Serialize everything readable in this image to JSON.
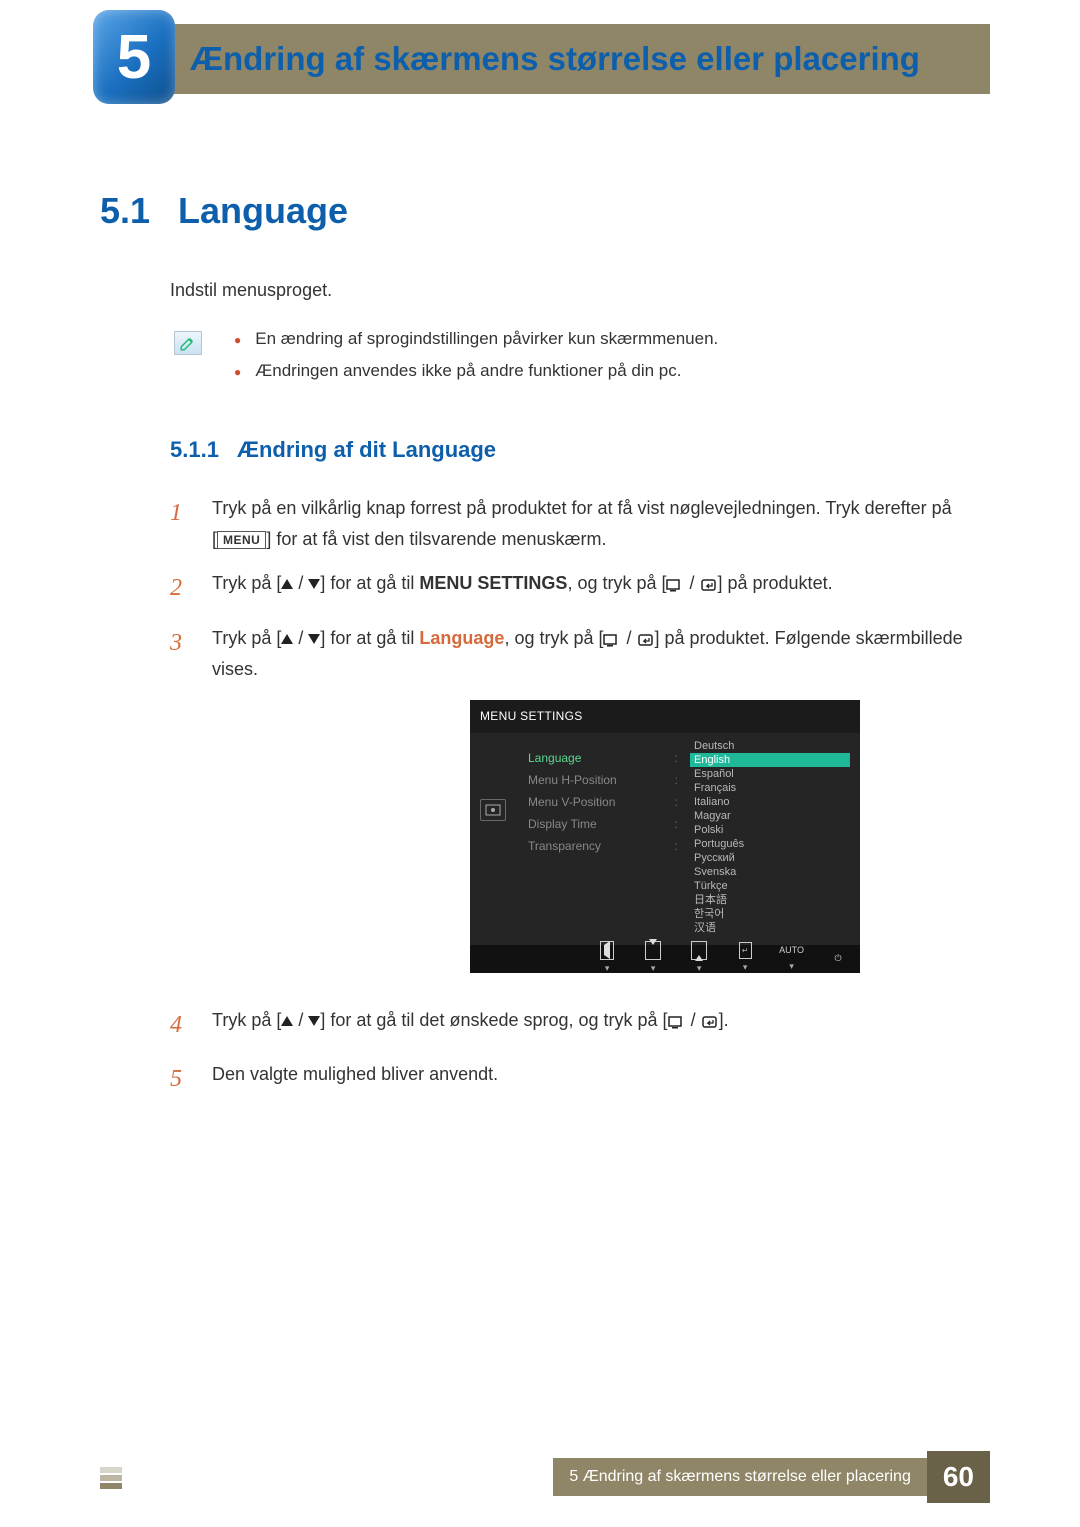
{
  "chapter_number": "5",
  "chapter_title": "Ændring af skærmens størrelse eller placering",
  "section": {
    "number": "5.1",
    "title": "Language"
  },
  "intro": "Indstil menusproget.",
  "notes": [
    "En ændring af sprogindstillingen påvirker kun skærmmenuen.",
    "Ændringen anvendes ikke på andre funktioner på din pc."
  ],
  "subsection": {
    "number": "5.1.1",
    "title": "Ændring af dit Language"
  },
  "steps": {
    "s1a": "Tryk på en vilkårlig knap forrest på produktet for at få vist nøglevejledningen. Tryk derefter på [",
    "s1_menu": "MENU",
    "s1b": "] for at få vist den tilsvarende menuskærm.",
    "s2a": "Tryk på [",
    "s2b": "] for at gå til ",
    "s2_bold": "MENU SETTINGS",
    "s2c": ", og tryk på [",
    "s2d": "] på produktet.",
    "s3a": "Tryk på [",
    "s3b": "] for at gå til ",
    "s3_bold": "Language",
    "s3c": ", og tryk på [",
    "s3d": "] på produktet. Følgende skærmbillede vises.",
    "s4a": "Tryk på [",
    "s4b": "] for at gå til det ønskede sprog, og tryk på [",
    "s4c": "].",
    "s5": "Den valgte mulighed bliver anvendt."
  },
  "osd": {
    "title": "MENU SETTINGS",
    "menu_items": [
      "Language",
      "Menu H-Position",
      "Menu V-Position",
      "Display Time",
      "Transparency"
    ],
    "languages": [
      "Deutsch",
      "English",
      "Español",
      "Français",
      "Italiano",
      "Magyar",
      "Polski",
      "Português",
      "Русский",
      "Svenska",
      "Türkçe",
      "日本語",
      "한국어",
      "汉语"
    ],
    "selected_language_index": 1,
    "auto_label": "AUTO"
  },
  "footer": {
    "text": "5 Ændring af skærmens størrelse eller placering",
    "page": "60"
  }
}
